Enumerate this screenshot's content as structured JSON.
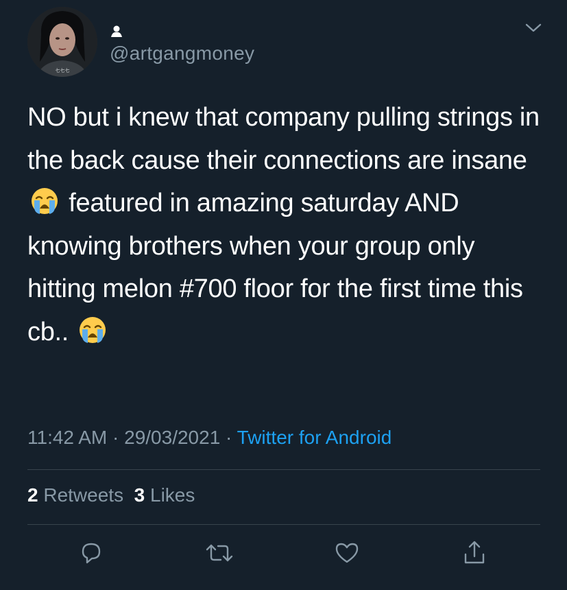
{
  "author": {
    "handle": "@artgangmoney",
    "avatar_caption": "七七七"
  },
  "tweet": {
    "text_part1": "NO but i knew that company pulling strings in the back cause their connections are insane",
    "emoji1": "loudly-crying-face",
    "text_part2": " featured in amazing saturday AND knowing brothers when your group only hitting melon #700 floor for the first time this cb.. ",
    "emoji2": "loudly-crying-face"
  },
  "meta": {
    "time": "11:42 AM",
    "sep1": " · ",
    "date": "29/03/2021",
    "sep2": " · ",
    "source": "Twitter for Android"
  },
  "stats": {
    "retweets_count": "2",
    "retweets_label": " Retweets",
    "likes_count": "3",
    "likes_label": " Likes"
  },
  "actions": [
    "reply-icon",
    "retweet-icon",
    "like-icon",
    "share-icon"
  ],
  "colors": {
    "background": "#15202b",
    "text": "#ffffff",
    "secondary": "#8899a6",
    "link": "#1da1f2",
    "divider": "#38444d"
  }
}
